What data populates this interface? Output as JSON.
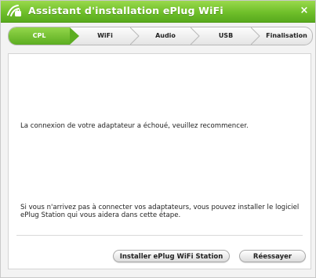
{
  "window": {
    "title": "Assistant d'installation ePlug WiFi",
    "close_symbol": "×",
    "icon": "wifi-plug-icon",
    "accent_color": "#6fbf2a"
  },
  "steps": [
    {
      "label": "CPL",
      "active": true
    },
    {
      "label": "WiFi",
      "active": false
    },
    {
      "label": "Audio",
      "active": false
    },
    {
      "label": "USB",
      "active": false
    },
    {
      "label": "Finalisation",
      "active": false
    }
  ],
  "content": {
    "error_message": "La connexion de votre adaptateur a échoué, veuillez recommencer.",
    "help_message": "Si vous n'arrivez pas à connecter vos adaptateurs, vous pouvez installer le logiciel ePlug Station qui vous aidera dans cette étape."
  },
  "buttons": {
    "install_label": "Installer ePlug WiFi Station",
    "retry_label": "Réessayer"
  }
}
